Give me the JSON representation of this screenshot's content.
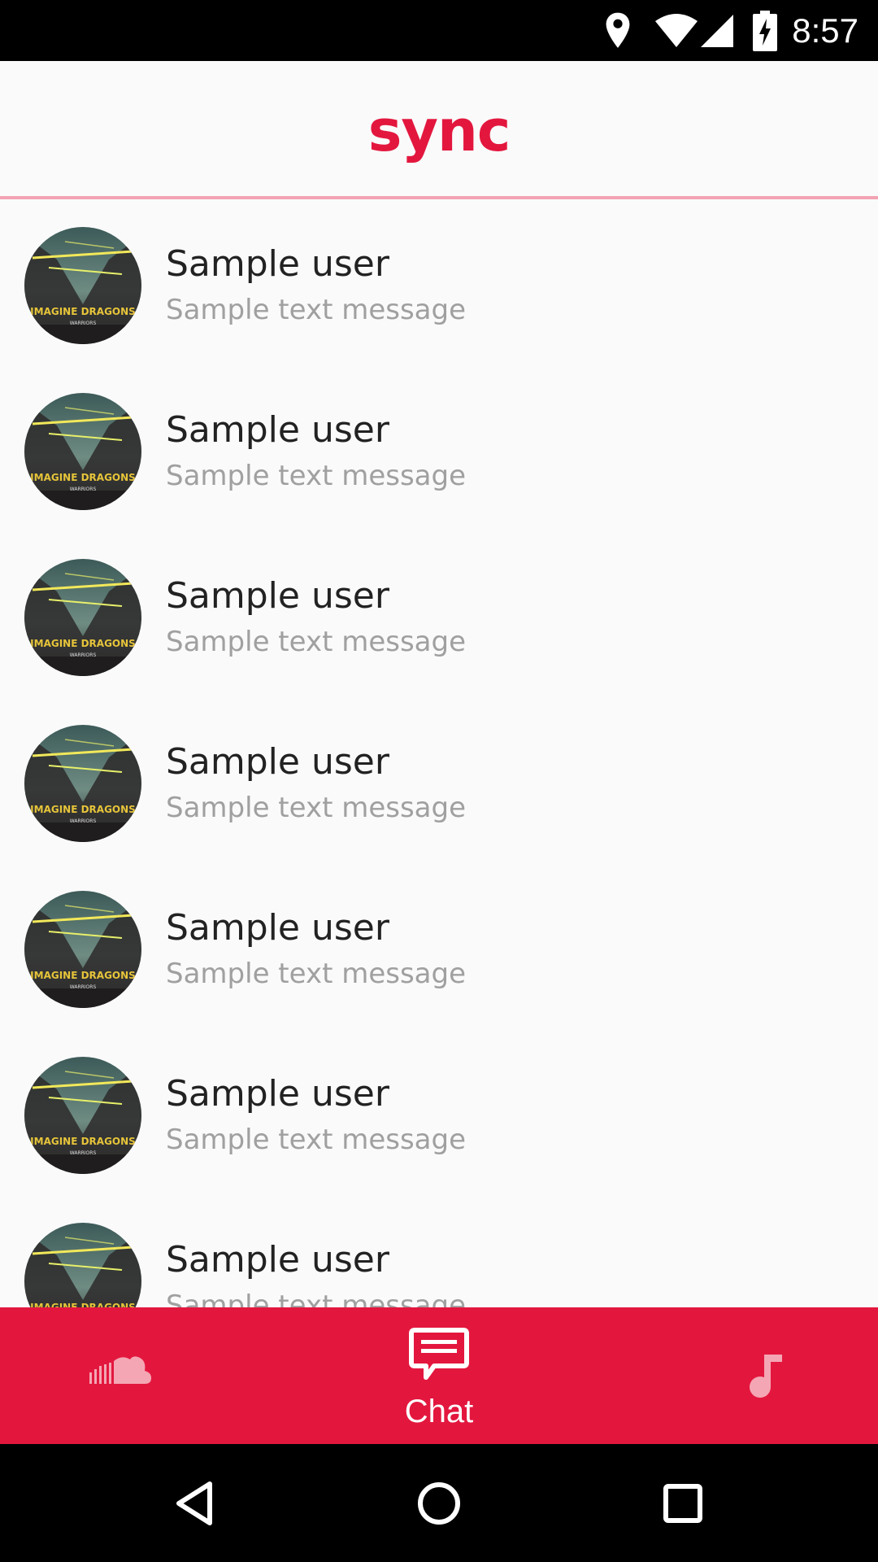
{
  "status_bar": {
    "time": "8:57",
    "icons": [
      "location-icon",
      "wifi-icon",
      "signal-icon",
      "battery-charging-icon"
    ]
  },
  "app_bar": {
    "title": "sync"
  },
  "conversations": [
    {
      "name": "Sample user",
      "message": "Sample text message",
      "avatar": "album-art-avatar"
    },
    {
      "name": "Sample user",
      "message": "Sample text message",
      "avatar": "album-art-avatar"
    },
    {
      "name": "Sample user",
      "message": "Sample text message",
      "avatar": "album-art-avatar"
    },
    {
      "name": "Sample user",
      "message": "Sample text message",
      "avatar": "album-art-avatar"
    },
    {
      "name": "Sample user",
      "message": "Sample text message",
      "avatar": "album-art-avatar"
    },
    {
      "name": "Sample user",
      "message": "Sample text message",
      "avatar": "album-art-avatar"
    },
    {
      "name": "Sample user",
      "message": "Sample text message",
      "avatar": "album-art-avatar"
    }
  ],
  "bottom_nav": {
    "items": [
      {
        "icon": "soundcloud-icon",
        "label": "",
        "active": false
      },
      {
        "icon": "chat-icon",
        "label": "Chat",
        "active": true
      },
      {
        "icon": "music-note-icon",
        "label": "",
        "active": false
      }
    ]
  },
  "system_nav": {
    "buttons": [
      "back-icon",
      "home-icon",
      "recents-icon"
    ]
  },
  "colors": {
    "accent": "#e3173e",
    "divider": "#f2a3b3",
    "primary_text": "#222222",
    "secondary_text": "#a0a0a0",
    "background": "#fafafa"
  }
}
